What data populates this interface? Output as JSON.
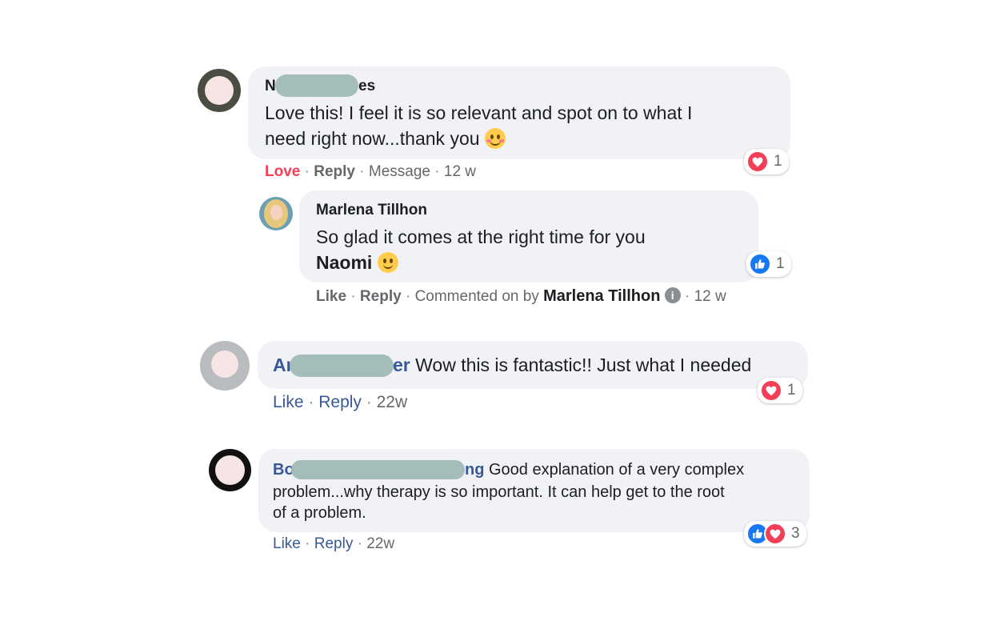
{
  "comments": [
    {
      "author_start": "N",
      "author_end": "es",
      "text_line1": "Love this! I feel it is so relevant and spot on to what I",
      "text_line2": "need right now...thank you",
      "emoji": "smiling-face-with-smiling-eyes",
      "reaction_count": "1",
      "actions": {
        "love": "Love",
        "reply": "Reply",
        "message": "Message",
        "time": "12 w"
      },
      "reply": {
        "author": "Marlena Tillhon",
        "text_line1": "So glad it comes at the right time for you",
        "mention": "Naomi",
        "emoji": "slightly-smiling-face",
        "reaction_count": "1",
        "actions": {
          "like": "Like",
          "reply": "Reply",
          "commented_on_by": "Commented on by",
          "commenter": "Marlena Tillhon",
          "time": "12 w"
        }
      }
    },
    {
      "author_start": "Ar",
      "author_end": "er",
      "text": "Wow this is fantastic!! Just what I needed",
      "reaction_count": "1",
      "actions": {
        "like": "Like",
        "reply": "Reply",
        "time": "22w"
      }
    },
    {
      "author_start": "Bo",
      "author_end": "ng",
      "text_line1": "Good explanation of a very complex",
      "text_line2": "problem...why therapy is so important. It can help get to the root",
      "text_line3": "of a problem.",
      "reaction_count": "3",
      "actions": {
        "like": "Like",
        "reply": "Reply",
        "time": "22w"
      }
    }
  ],
  "separator": "·",
  "colors": {
    "bubble": "#f0f2f5",
    "love": "#f33e58",
    "like": "#1877f2",
    "link": "#385898",
    "redaction": "#a4bdb9",
    "face_blur": "#f7e4e4"
  }
}
